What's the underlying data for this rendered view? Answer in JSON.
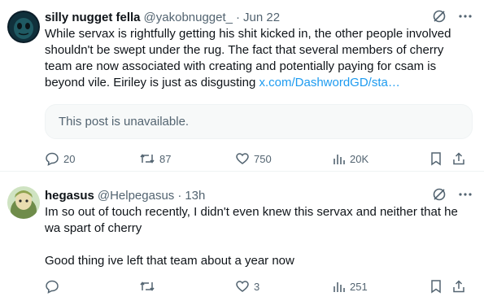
{
  "tweets": [
    {
      "name": "silly nugget fella",
      "handle": "@yakobnugget_",
      "separator": "·",
      "time": "Jun 22",
      "text": "While servax is rightfully getting his shit kicked in, the other people involved shouldn't be swept under the rug. The fact that several members of cherry team are now associated with creating and potentially paying for csam is beyond vile. Eiriley is just as disgusting",
      "link": "x.com/DashwordGD/sta…",
      "quote_unavailable": "This post is unavailable.",
      "stats": {
        "replies": "20",
        "reposts": "87",
        "likes": "750",
        "views": "20K"
      }
    },
    {
      "name": "hegasus",
      "handle": "@Helpegasus",
      "separator": "·",
      "time": "13h",
      "text": "Im so out of touch recently, I didn't even knew this servax and neither that he wa spart of cherry\n\nGood thing ive left that team about a year now",
      "stats": {
        "replies": "",
        "reposts": "",
        "likes": "3",
        "views": "251"
      }
    }
  ],
  "colors": {
    "text": "#0f1419",
    "muted": "#536471",
    "link": "#1d9bf0",
    "border": "#eff3f4"
  }
}
